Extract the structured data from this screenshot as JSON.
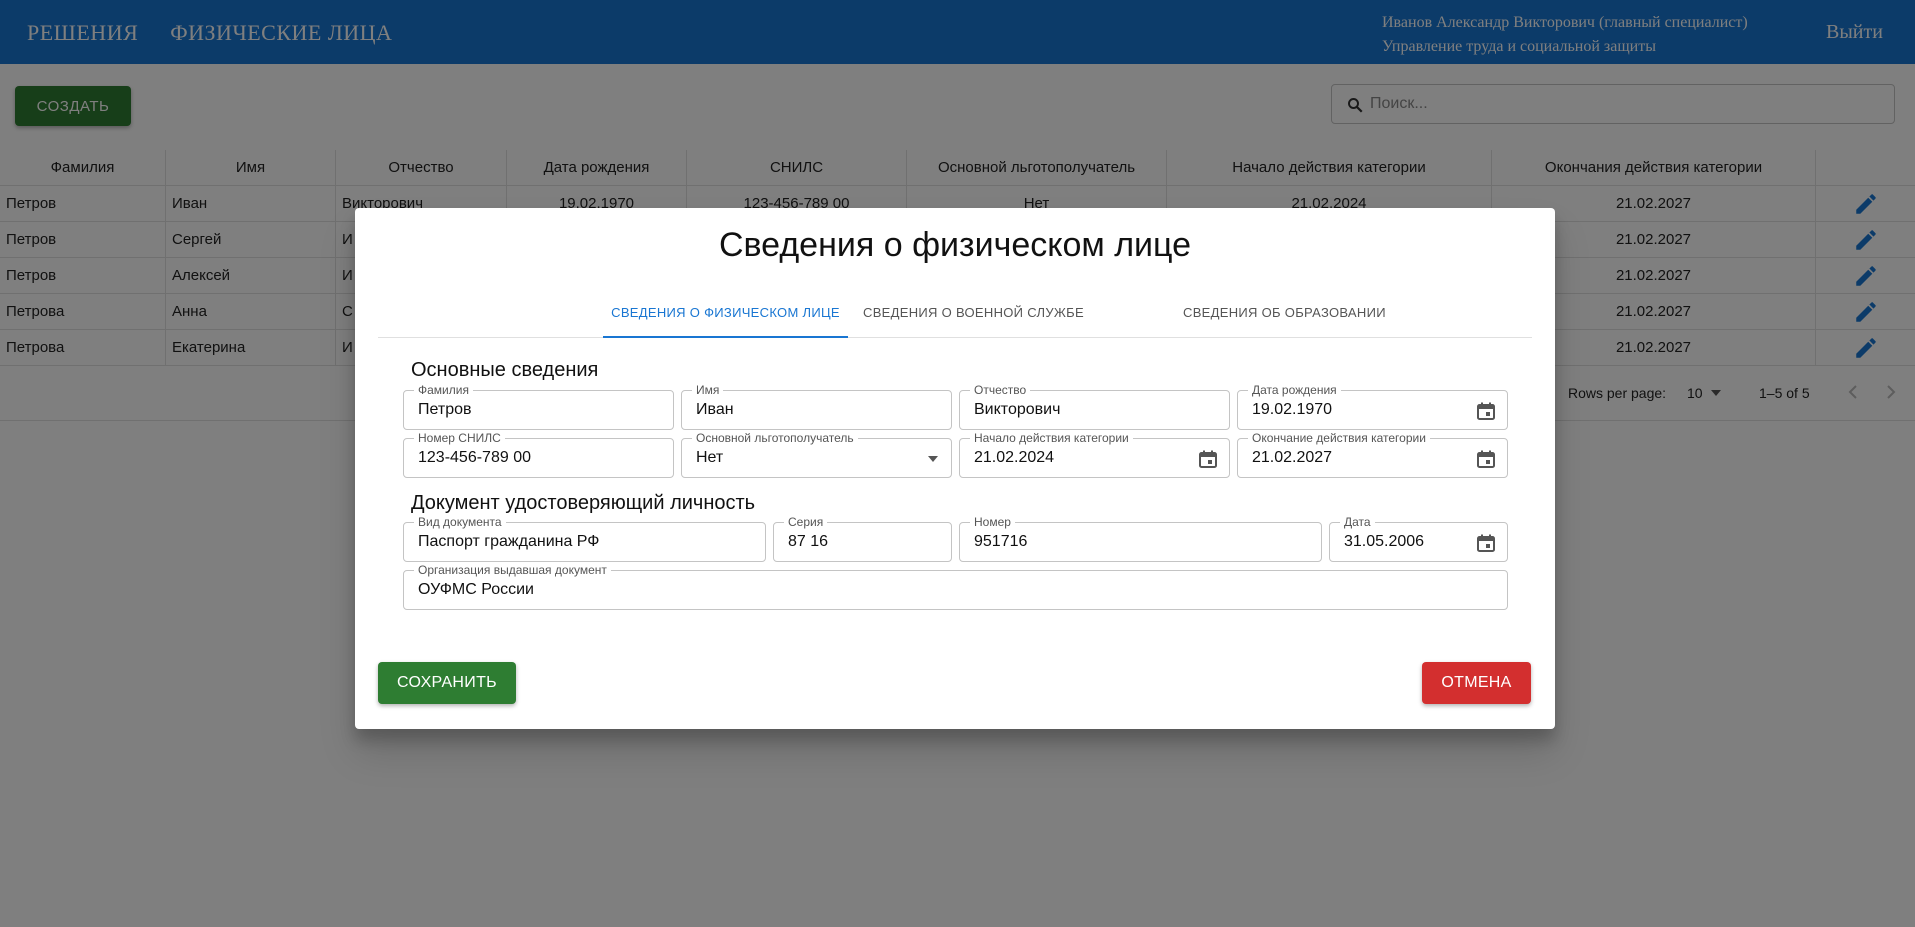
{
  "header": {
    "nav": [
      "РЕШЕНИЯ",
      "ФИЗИЧЕСКИЕ ЛИЦА"
    ],
    "user_name": "Иванов Александр Викторович (главный специалист)",
    "user_org": "Управление труда и социальной защиты",
    "logout": "Выйти"
  },
  "toolbar": {
    "create_label": "СОЗДАТЬ",
    "search_placeholder": "Поиск..."
  },
  "table": {
    "columns": [
      "Фамилия",
      "Имя",
      "Отчество",
      "Дата рождения",
      "СНИЛС",
      "Основной льготополучатель",
      "Начало действия категории",
      "Окончания действия категории"
    ],
    "rows": [
      [
        "Петров",
        "Иван",
        "Викторович",
        "19.02.1970",
        "123-456-789 00",
        "Нет",
        "21.02.2024",
        "21.02.2027"
      ],
      [
        "Петров",
        "Сергей",
        "И",
        "",
        "",
        "",
        "",
        "21.02.2027"
      ],
      [
        "Петров",
        "Алексей",
        "И",
        "",
        "",
        "",
        "",
        "21.02.2027"
      ],
      [
        "Петрова",
        "Анна",
        "С",
        "",
        "",
        "",
        "",
        "21.02.2027"
      ],
      [
        "Петрова",
        "Екатерина",
        "И",
        "",
        "",
        "",
        "",
        "21.02.2027"
      ]
    ],
    "rows_per_page_label": "Rows per page:",
    "rows_per_page_value": "10",
    "range": "1–5 of 5"
  },
  "dialog": {
    "title": "Сведения о физическом лице",
    "tabs": [
      "СВЕДЕНИЯ О ФИЗИЧЕСКОМ ЛИЦЕ",
      "СВЕДЕНИЯ О ВОЕННОЙ СЛУЖБЕ",
      "СВЕДЕНИЯ ОБ ОБРАЗОВАНИИ"
    ],
    "active_tab": 0,
    "section_main": "Основные сведения",
    "section_doc": "Документ удостоверяющий личность",
    "fields": {
      "last_name": {
        "label": "Фамилия",
        "value": "Петров"
      },
      "first_name": {
        "label": "Имя",
        "value": "Иван"
      },
      "patronymic": {
        "label": "Отчество",
        "value": "Викторович"
      },
      "birth_date": {
        "label": "Дата рождения",
        "value": "19.02.1970"
      },
      "snils": {
        "label": "Номер СНИЛС",
        "value": "123-456-789 00"
      },
      "main_beneficiary": {
        "label": "Основной льготополучатель",
        "value": "Нет"
      },
      "category_start": {
        "label": "Начало действия категории",
        "value": "21.02.2024"
      },
      "category_end": {
        "label": "Окончание действия категории",
        "value": "21.02.2027"
      },
      "doc_type": {
        "label": "Вид документа",
        "value": "Паспорт гражданина РФ"
      },
      "doc_series": {
        "label": "Серия",
        "value": "87 16"
      },
      "doc_number": {
        "label": "Номер",
        "value": "951716"
      },
      "doc_date": {
        "label": "Дата",
        "value": "31.05.2006"
      },
      "doc_issuer": {
        "label": "Организация выдавшая документ",
        "value": "ОУФМС России"
      }
    },
    "save_label": "СОХРАНИТЬ",
    "cancel_label": "ОТМЕНА"
  },
  "colors": {
    "primary": "#1976d2",
    "success": "#2e7d32",
    "danger": "#d32f2f"
  }
}
